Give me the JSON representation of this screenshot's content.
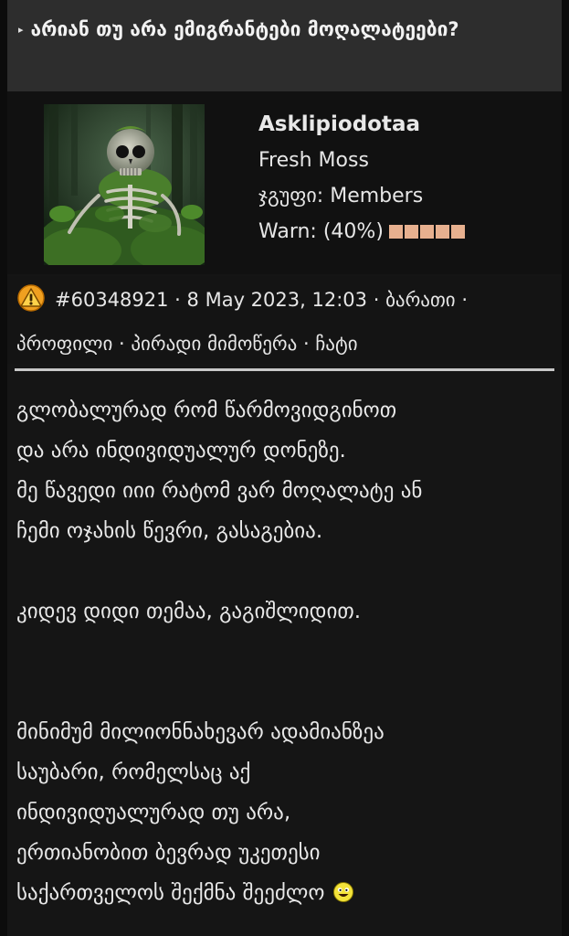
{
  "topic": {
    "title": "არიან თუ არა ემიგრანტები მოღალატეები?"
  },
  "author": {
    "name": "Asklipiodotaa",
    "rank": "Fresh Moss",
    "group": "ჯგუფი: Members",
    "warn": "Warn: (40%)",
    "warn_level": 0.4,
    "avatar_icon": "skeleton-in-moss-avatar"
  },
  "post": {
    "number": "#60348921",
    "date": "8 May 2023, 12:03",
    "sep": "·",
    "links": {
      "card": "ბარათი",
      "profile": "პროფილი",
      "pm": "პირადი მიმოწერა",
      "chat": "ჩატი"
    },
    "body": {
      "p1_l1": "გლობალურად რომ წარმოვიდგინოთ",
      "p1_l2": "და არა ინდივიდუალურ დონეზე.",
      "p1_l3": "მე წავედი იიი რატომ ვარ მოღალატე ან",
      "p1_l4": "ჩემი ოჯახის წევრი, გასაგებია.",
      "p2_l1": "კიდევ დიდი თემაა, გაგიშლიდით.",
      "p3_l1": "მინიმუმ მილიონნახევარ ადამიანზეა",
      "p3_l2": "საუბარი, რომელსაც აქ",
      "p3_l3": "ინდივიდუალურად თუ არა,",
      "p3_l4": "ერთიანობით ბევრად უკეთესი",
      "p3_l5": "საქართველოს შექმნა შეეძლო"
    }
  },
  "icons": {
    "warning": "warning-icon",
    "smiley": "smiley-icon",
    "arrow": "topic-arrow-icon"
  },
  "colors": {
    "warn_segment": "#e7b08f",
    "warning_icon": "#f0a020"
  }
}
